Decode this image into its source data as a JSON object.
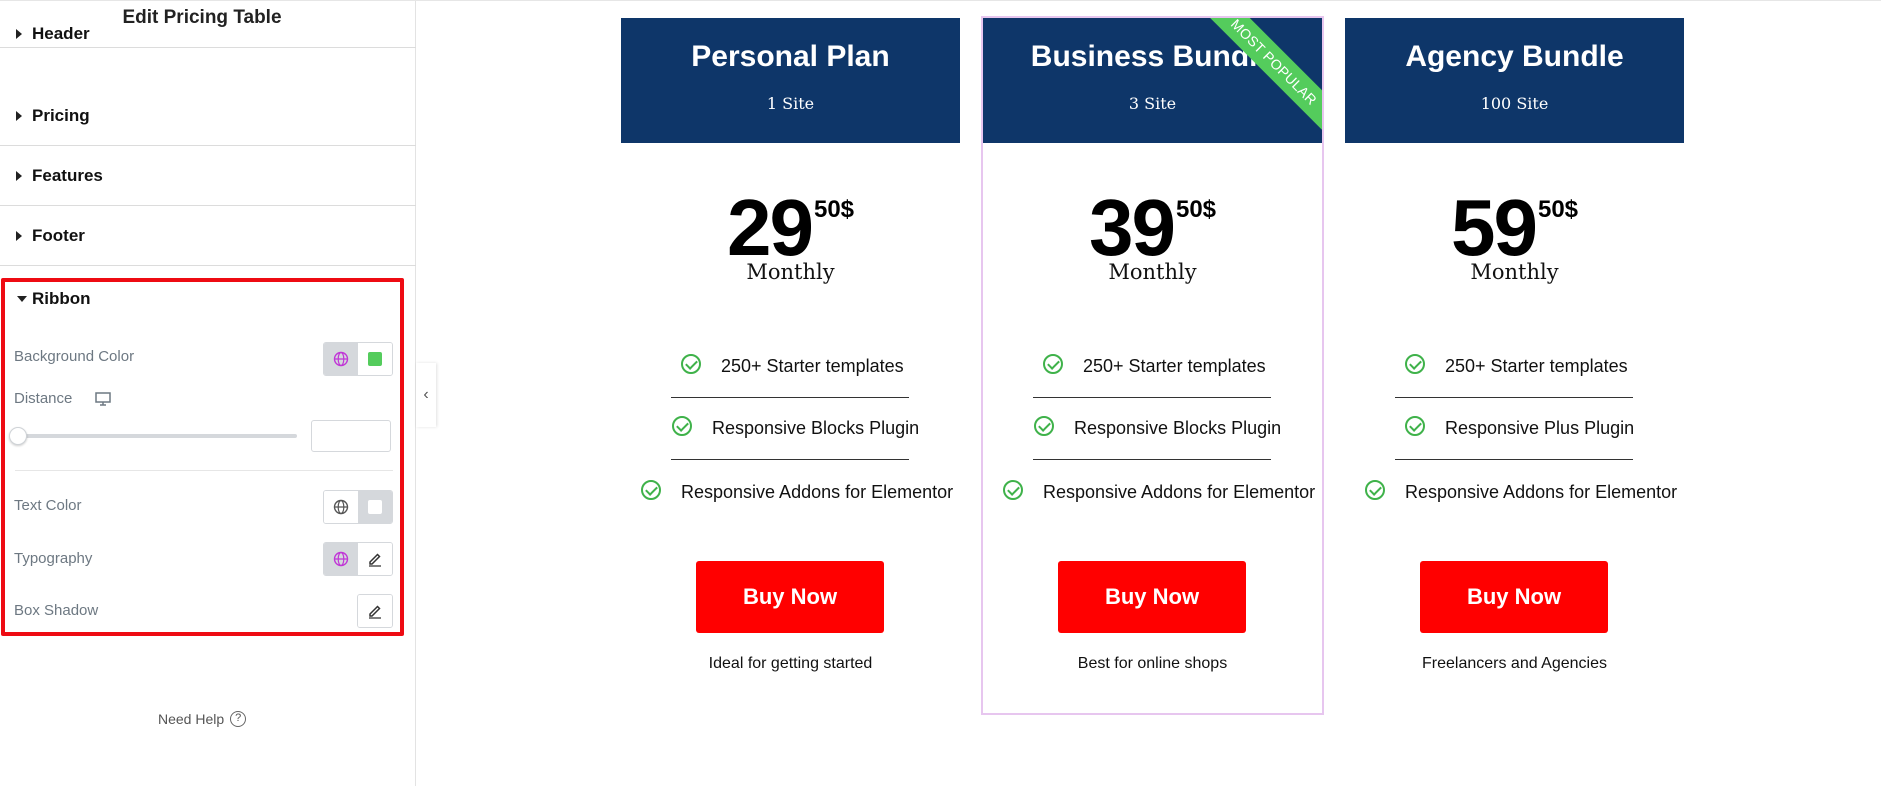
{
  "panel": {
    "title": "Edit Pricing Table",
    "sections": [
      "Header",
      "Pricing",
      "Features",
      "Footer"
    ],
    "ribbon": {
      "title": "Ribbon",
      "background_color_label": "Background Color",
      "background_color": "#54cc5c",
      "distance_label": "Distance",
      "distance_value": "",
      "text_color_label": "Text Color",
      "typography_label": "Typography",
      "box_shadow_label": "Box Shadow"
    },
    "need_help": "Need Help",
    "help_glyph": "?"
  },
  "collapse_glyph": "‹",
  "cards": [
    {
      "title": "Personal Plan",
      "subtitle": "1 Site",
      "price": "29",
      "price_fraction": "50$",
      "period": "Monthly",
      "features": [
        "250+ Starter templates",
        "Responsive Blocks Plugin",
        "Responsive Addons for Elementor"
      ],
      "button": "Buy Now",
      "tagline": "Ideal for getting started"
    },
    {
      "title": "Business Bundle",
      "subtitle": "3 Site",
      "price": "39",
      "price_fraction": "50$",
      "period": "Monthly",
      "ribbon": "MOST POPULAR",
      "features": [
        "250+ Starter templates",
        "Responsive Blocks Plugin",
        "Responsive Addons for Elementor"
      ],
      "button": "Buy Now",
      "tagline": "Best for online shops"
    },
    {
      "title": "Agency Bundle",
      "subtitle": "100 Site",
      "price": "59",
      "price_fraction": "50$",
      "period": "Monthly",
      "features": [
        "250+ Starter templates",
        "Responsive Plus Plugin",
        "Responsive Addons for Elementor"
      ],
      "button": "Buy Now",
      "tagline": "Freelancers and Agencies"
    }
  ],
  "colors": {
    "header_bg": "#0e3669",
    "button_bg": "#ff0000",
    "ribbon_bg": "#54cc5c",
    "check": "#3fb24a",
    "highlight_border": "#ee0b13"
  }
}
